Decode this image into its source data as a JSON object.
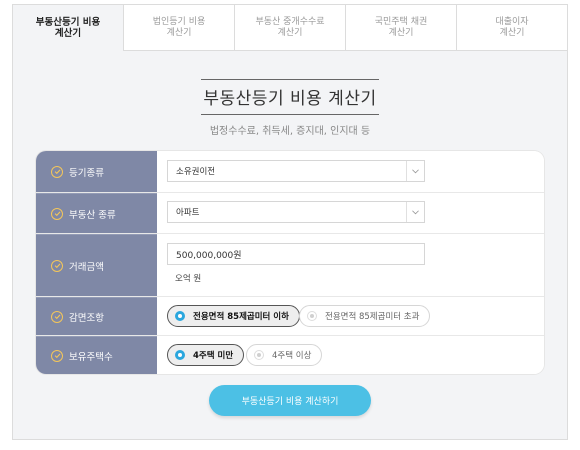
{
  "tabs": [
    {
      "label": "부동산등기 비용\n계산기",
      "active": true
    },
    {
      "label": "법인등기 비용\n계산기",
      "active": false
    },
    {
      "label": "부동산 중개수수료\n계산기",
      "active": false
    },
    {
      "label": "국민주택 채권\n계산기",
      "active": false
    },
    {
      "label": "대출이자\n계산기",
      "active": false
    }
  ],
  "heading": {
    "title": "부동산등기 비용 계산기",
    "subtitle": "법정수수료, 취득세, 증지대, 인지대 등"
  },
  "form": {
    "registration_type": {
      "label": "등기종류",
      "value": "소유권이전"
    },
    "property_type": {
      "label": "부동산 종류",
      "value": "아파트"
    },
    "amount": {
      "label": "거래금액",
      "value": "500,000,000원",
      "hint": "오억 원"
    },
    "reduction": {
      "label": "감면조항",
      "options": [
        "전용면적 85제곱미터 이하",
        "전용면적 85제곱미터 초과"
      ],
      "selected": 0
    },
    "houses": {
      "label": "보유주택수",
      "options": [
        "4주택 미만",
        "4주택 이상"
      ],
      "selected": 0
    }
  },
  "submit_label": "부동산등기 비용 계산하기",
  "colors": {
    "label_bg": "#7f88a6",
    "check_icon": "#f4c65a",
    "accent": "#2aa7de",
    "button": "#4cc0e5"
  }
}
